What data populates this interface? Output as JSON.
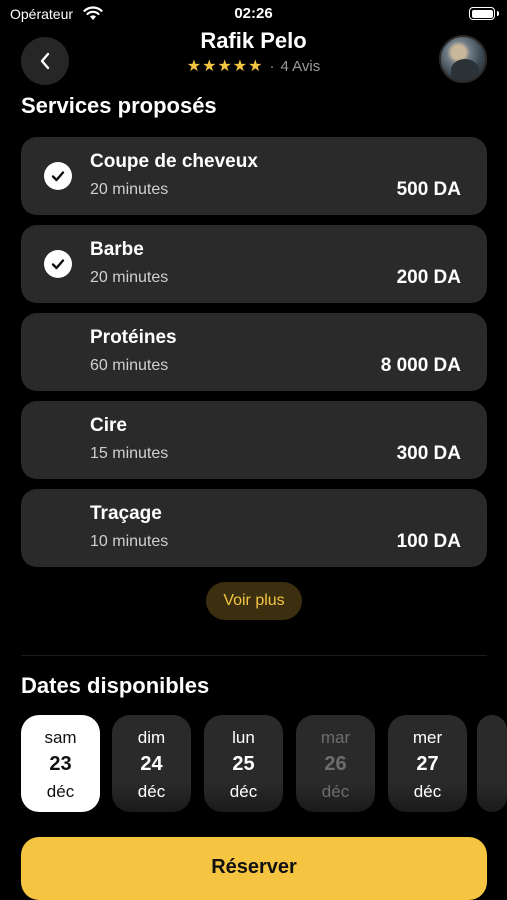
{
  "status_bar": {
    "carrier": "Opérateur",
    "time": "02:26"
  },
  "header": {
    "title": "Rafik Pelo",
    "stars": "★★★★★",
    "separator": "·",
    "reviews": "4 Avis"
  },
  "services_section": {
    "title": "Services proposés",
    "items": [
      {
        "name": "Coupe de cheveux",
        "duration": "20 minutes",
        "price": "500 DA",
        "selected": true
      },
      {
        "name": "Barbe",
        "duration": "20 minutes",
        "price": "200 DA",
        "selected": true
      },
      {
        "name": "Protéines",
        "duration": "60 minutes",
        "price": "8 000 DA",
        "selected": false
      },
      {
        "name": "Cire",
        "duration": "15 minutes",
        "price": "300 DA",
        "selected": false
      },
      {
        "name": "Traçage",
        "duration": "10 minutes",
        "price": "100 DA",
        "selected": false
      }
    ],
    "more_label": "Voir plus"
  },
  "dates_section": {
    "title": "Dates disponibles",
    "dates": [
      {
        "dow": "sam",
        "day": "23",
        "month": "déc",
        "state": "selected"
      },
      {
        "dow": "dim",
        "day": "24",
        "month": "déc",
        "state": "available"
      },
      {
        "dow": "lun",
        "day": "25",
        "month": "déc",
        "state": "available"
      },
      {
        "dow": "mar",
        "day": "26",
        "month": "déc",
        "state": "disabled"
      },
      {
        "dow": "mer",
        "day": "27",
        "month": "déc",
        "state": "available"
      }
    ]
  },
  "footer": {
    "reserve_label": "Réserver"
  },
  "colors": {
    "accent": "#f5c542",
    "card_bg": "#2a2a2a",
    "background": "#000000"
  }
}
